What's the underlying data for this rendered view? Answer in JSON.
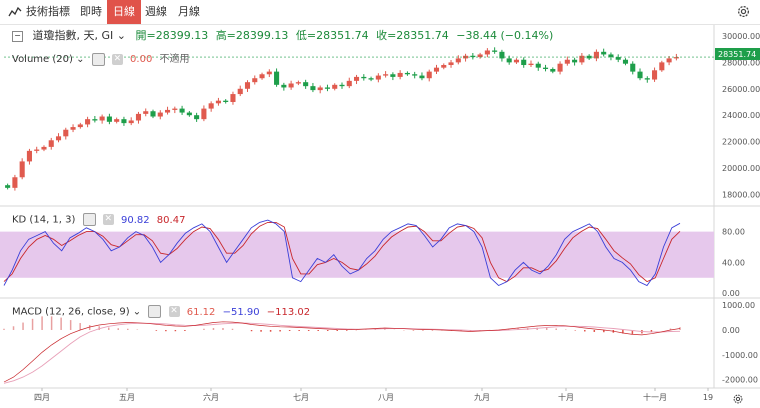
{
  "toolbar": {
    "indicators_label": "技術指標",
    "tabs": [
      "即時",
      "日線",
      "週線",
      "月線"
    ],
    "active_tab": "日線"
  },
  "main_panel": {
    "title": "道瓊指數, 天, GI",
    "open": "開=28399.13",
    "high": "高=28399.13",
    "low": "低=28351.74",
    "close": "收=28351.74",
    "change": "−38.44 (−0.14%)",
    "volume_label": "Volume (20)",
    "volume_value": "0.00",
    "volume_note": "不適用",
    "price_tag": "28351.74"
  },
  "kd_panel": {
    "label": "KD (14, 1, 3)",
    "k_value": "90.82",
    "d_value": "80.47"
  },
  "macd_panel": {
    "label": "MACD (12, 26, close, 9)",
    "v1": "61.12",
    "v2": "−51.90",
    "v3": "−113.02"
  },
  "colors": {
    "up": "#e05a4e",
    "down": "#1e9e4a",
    "k_line": "#3a3fd8",
    "d_line": "#c8262b",
    "kd_band": "#e6c8ec"
  },
  "chart_data": [
    {
      "type": "candlestick",
      "y_ticks": [
        18000,
        20000,
        22000,
        24000,
        26000,
        28000,
        30000
      ],
      "ylim": [
        17200,
        30300
      ],
      "x_ticks": [
        "四月",
        "五月",
        "六月",
        "七月",
        "八月",
        "九月",
        "十月",
        "十一月",
        "19"
      ],
      "close_series": [
        18500,
        19300,
        20500,
        21300,
        21400,
        21600,
        22100,
        22400,
        22900,
        23100,
        23300,
        23700,
        23600,
        23900,
        23500,
        23700,
        23400,
        23600,
        24100,
        24300,
        23900,
        24200,
        24400,
        24500,
        24200,
        24000,
        23700,
        24500,
        24900,
        25100,
        25000,
        25600,
        26000,
        26500,
        26800,
        27100,
        27300,
        26300,
        26100,
        26400,
        26500,
        26200,
        25900,
        26100,
        26000,
        26300,
        26200,
        26600,
        26900,
        26800,
        26700,
        27000,
        27100,
        26900,
        27200,
        27100,
        27000,
        26800,
        27300,
        27600,
        27800,
        28000,
        28300,
        28500,
        28400,
        28600,
        28900,
        28800,
        28300,
        28000,
        28200,
        27800,
        27900,
        27600,
        27500,
        27300,
        27900,
        28200,
        28000,
        28500,
        28300,
        28800,
        28600,
        28400,
        28200,
        27900,
        27300,
        26800,
        26700,
        27400,
        28000,
        28300,
        28399
      ]
    },
    {
      "type": "line",
      "name": "KD",
      "y_ticks": [
        0,
        40,
        80
      ],
      "ylim": [
        -5,
        112
      ],
      "band": [
        20,
        80
      ],
      "k": [
        10,
        30,
        55,
        70,
        75,
        80,
        65,
        55,
        72,
        78,
        85,
        80,
        70,
        55,
        60,
        72,
        80,
        75,
        60,
        40,
        50,
        65,
        78,
        85,
        90,
        80,
        60,
        40,
        55,
        70,
        85,
        92,
        95,
        90,
        80,
        20,
        15,
        30,
        45,
        40,
        50,
        35,
        25,
        30,
        45,
        55,
        70,
        80,
        85,
        90,
        88,
        75,
        60,
        70,
        85,
        90,
        88,
        80,
        60,
        20,
        10,
        15,
        30,
        40,
        30,
        25,
        35,
        50,
        70,
        80,
        85,
        90,
        80,
        60,
        45,
        40,
        30,
        15,
        10,
        25,
        60,
        85,
        90.82
      ],
      "d": [
        15,
        25,
        45,
        60,
        70,
        75,
        70,
        62,
        68,
        75,
        80,
        80,
        74,
        63,
        60,
        68,
        76,
        76,
        68,
        52,
        50,
        58,
        70,
        80,
        86,
        84,
        70,
        52,
        52,
        62,
        77,
        87,
        92,
        92,
        86,
        45,
        25,
        25,
        37,
        40,
        45,
        40,
        32,
        30,
        38,
        48,
        62,
        73,
        80,
        86,
        87,
        80,
        68,
        68,
        78,
        86,
        88,
        84,
        72,
        40,
        20,
        15,
        22,
        33,
        33,
        28,
        31,
        42,
        58,
        72,
        80,
        86,
        84,
        70,
        55,
        46,
        38,
        24,
        15,
        20,
        45,
        70,
        80.47
      ]
    },
    {
      "type": "line",
      "name": "MACD",
      "y_ticks": [
        -2000,
        -1000,
        0,
        1000
      ],
      "ylim": [
        -2300,
        1250
      ],
      "macd": [
        -2100,
        -1900,
        -1600,
        -1250,
        -900,
        -600,
        -350,
        -150,
        0,
        120,
        200,
        250,
        280,
        300,
        290,
        270,
        230,
        190,
        160,
        150,
        180,
        240,
        300,
        330,
        320,
        280,
        220,
        180,
        150,
        130,
        120,
        100,
        80,
        60,
        40,
        20,
        10,
        20,
        40,
        60,
        80,
        70,
        50,
        30,
        20,
        10,
        0,
        -20,
        -40,
        -60,
        -40,
        -20,
        0,
        40,
        80,
        120,
        160,
        180,
        190,
        170,
        130,
        80,
        40,
        0,
        -50,
        -120,
        -180,
        -200,
        -150,
        -80,
        0,
        61.12
      ],
      "signal": [
        -2150,
        -2050,
        -1900,
        -1700,
        -1450,
        -1150,
        -850,
        -550,
        -280,
        -80,
        50,
        150,
        210,
        250,
        270,
        270,
        260,
        240,
        210,
        190,
        180,
        190,
        220,
        250,
        270,
        280,
        270,
        250,
        220,
        190,
        160,
        140,
        120,
        100,
        80,
        60,
        40,
        30,
        30,
        40,
        50,
        60,
        60,
        50,
        40,
        30,
        20,
        10,
        0,
        -15,
        -25,
        -25,
        -20,
        -5,
        15,
        40,
        70,
        100,
        130,
        150,
        150,
        140,
        120,
        90,
        60,
        20,
        -20,
        -60,
        -80,
        -80,
        -60,
        -51.9
      ]
    }
  ]
}
